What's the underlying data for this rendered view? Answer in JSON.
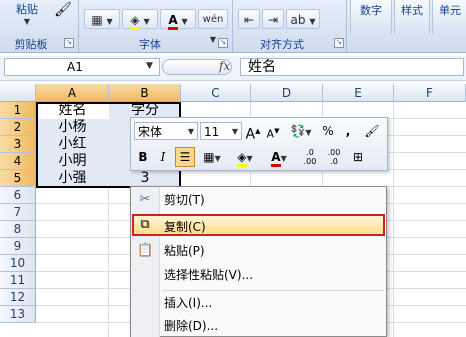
{
  "ribbon": {
    "paste_label": "粘贴",
    "groups": {
      "clipboard": "剪贴板",
      "font": "字体",
      "alignment": "对齐方式",
      "number_btn": "数字",
      "style_btn": "样式",
      "cells_btn": "单元"
    }
  },
  "formula_bar": {
    "name_box": "A1",
    "fx": "fx",
    "formula": "姓名"
  },
  "sheet": {
    "columns": [
      "A",
      "B",
      "C",
      "D",
      "E",
      "F"
    ],
    "rows": [
      "1",
      "2",
      "3",
      "4",
      "5",
      "6",
      "7",
      "8",
      "9",
      "10",
      "11",
      "12",
      "13"
    ],
    "cells": {
      "a1": "姓名",
      "b1": "学分",
      "a2": "小杨",
      "a3": "小红",
      "a4": "小明",
      "a5": "小强",
      "b5": "3"
    }
  },
  "mini_toolbar": {
    "font_name": "宋体",
    "font_size": "11",
    "grow_font": "A",
    "shrink_font": "A",
    "percent": "%",
    "comma": ",",
    "bold": "B",
    "italic": "I",
    "font_color": "A",
    "inc_decimal": ".0\n.00",
    "dec_decimal": ".00\n.0"
  },
  "context_menu": {
    "items": [
      {
        "label": "剪切(T)",
        "icon": "scissors-icon"
      },
      {
        "label": "复制(C)",
        "icon": "copy-icon"
      },
      {
        "label": "粘贴(P)",
        "icon": "paste-icon"
      },
      {
        "label": "选择性粘贴(V)...",
        "icon": ""
      },
      {
        "label": "插入(I)...",
        "icon": ""
      },
      {
        "label": "删除(D)...",
        "icon": ""
      }
    ]
  },
  "colors": {
    "selection_highlight": "#f0b963",
    "menu_highlight_border": "#d1211f",
    "ribbon_label": "#15428b"
  }
}
